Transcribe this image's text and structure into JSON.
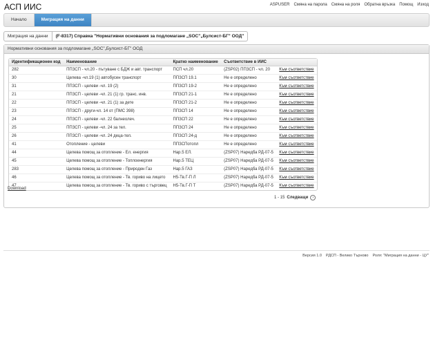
{
  "app": {
    "title": "АСП ИИС"
  },
  "top_links": [
    "ASPUSER",
    "Смяна на парола",
    "Смяна на роля",
    "Обратна връзка",
    "Помощ",
    "Изход"
  ],
  "nav": {
    "tabs": [
      {
        "label": "Начало"
      },
      {
        "label": "Миграция на данни"
      }
    ]
  },
  "breadcrumb": {
    "item1": "Миграция на данни",
    "item2": "(F-8317) Справка \"Нормативни основания за подломагане „SOC\"„Булсист-БГ\" ООД\""
  },
  "panel": {
    "title": "Нормативни основания за подломагане „SOC\"„Булсист-БГ\" ООД"
  },
  "table": {
    "headers": [
      "Идентификационен код",
      "Наименование",
      "Кратко наименование",
      "Съответствие в ИИС",
      ""
    ],
    "rows": [
      [
        "282",
        "ППЗСП - чл.20 - пътуване с БДЖ и авт. транспорт",
        "ПСП чл.20",
        "(ZSP02) ППЗСП - чл. 20",
        "Към съответствие"
      ],
      [
        "30",
        "Целева -чл.19 (1) автобусен транспорт",
        "ППЗСП 19.1",
        "Не е определено",
        "Към съответствие"
      ],
      [
        "31",
        "ППЗСП - целеви -чл. 19 (2)",
        "ППЗСП 19-2",
        "Не е определено",
        "Към съответствие"
      ],
      [
        "21",
        "ППЗСП - целеви -чл. 21 (1) гр. транс. инв.",
        "ППЗСП 21-1",
        "Не е определено",
        "Към съответствие"
      ],
      [
        "22",
        "ППЗСП - целеви -чл. 21 (1) за дете",
        "ППЗСП 21-2",
        "Не е определено",
        "Към съответствие"
      ],
      [
        "23",
        "ППЗСП - други-чл. 14 от (ПМС 398)",
        "ППЗСП 14",
        "Не е определено",
        "Към съответствие"
      ],
      [
        "24",
        "ППЗСП - целеви -чл. 22 балнеолеч.",
        "ППЗСП 22",
        "Не е определено",
        "Към съответствие"
      ],
      [
        "25",
        "ППЗСП - целеви -чл. 24 за тел.",
        "ППЗСП 24",
        "Не е определено",
        "Към съответствие"
      ],
      [
        "26",
        "ППЗСП - целеви -чл. 24 деца-тел.",
        "ППЗСП 24-д",
        "Не е определено",
        "Към съответствие"
      ],
      [
        "41",
        "Отопление - целеви",
        "ППЗСПотопл",
        "Не е определено",
        "Към съответствие"
      ],
      [
        "44",
        "Целева помощ за отопление - Ел. енергия",
        "Нар.5 ЕЛ.",
        "(ZSP07) Наредба РД-07-5",
        "Към съответствие"
      ],
      [
        "45",
        "Целева помощ за отопление - Топлоенергия",
        "Нар.5 ТЕЦ",
        "(ZSP07) Наредба РД-07-5",
        "Към съответствие"
      ],
      [
        "283",
        "Целева помощ за отопление - Природен Газ",
        "Нар.5 ГАЗ",
        "(ZSP07) Наредба РД-07-5",
        "Към съответствие"
      ],
      [
        "46",
        "Целева помощ за отопление - Тв. гориво на лицето",
        "Н5-Тв.Г-П Л",
        "(ZSP07) Наредба РД-07-5",
        "Към съответствие"
      ],
      [
        "47",
        "Целева помощ за отопление - Тв. гориво с търговец",
        "Н5-Тв.Г-П Т",
        "(ZSP07) Наредба РД-07-5",
        "Към съответствие"
      ]
    ]
  },
  "download_label": "Download",
  "pager": {
    "range": "1 - 15",
    "next_label": "Следващи",
    "next_icon": "›"
  },
  "footer": {
    "version": "Версия 1.0",
    "office": "РДСП - Велико Търново",
    "role": "Роля: \"Миграция на данни - ЦУ\""
  }
}
